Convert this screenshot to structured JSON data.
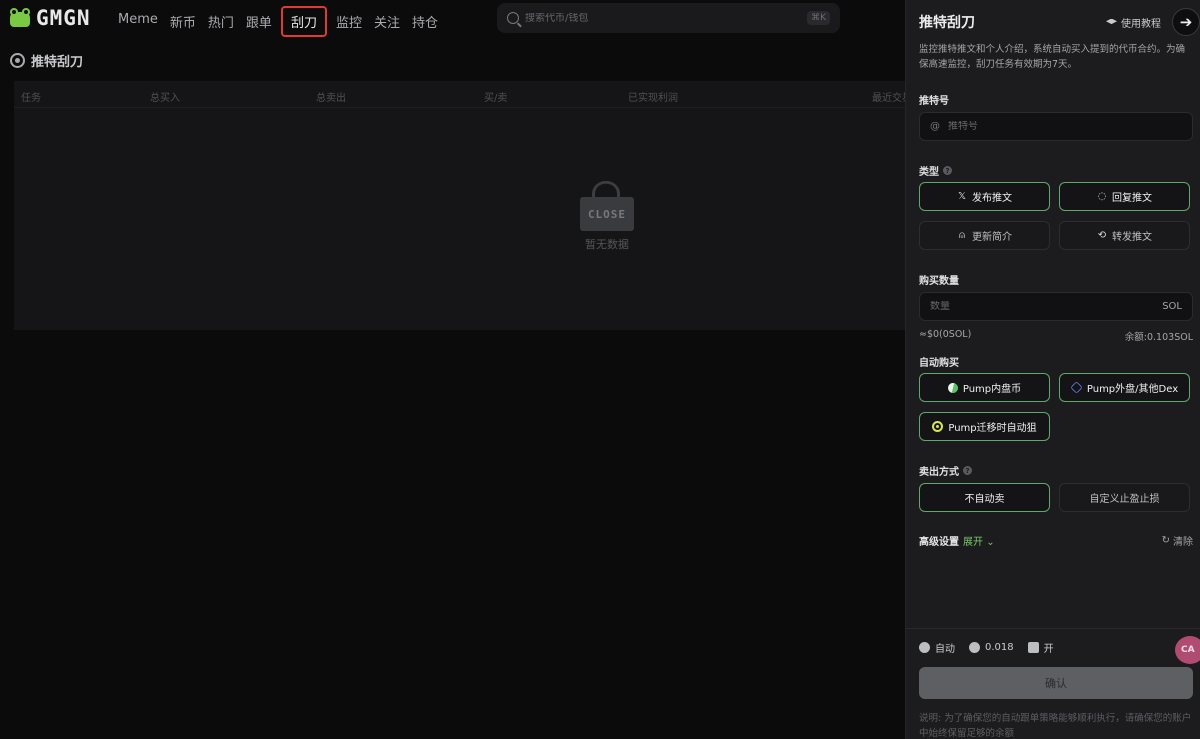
{
  "logo": {
    "text": "GMGN"
  },
  "nav": {
    "items": [
      {
        "label": "Meme"
      },
      {
        "label": "新币"
      },
      {
        "label": "热门"
      },
      {
        "label": "跟单"
      },
      {
        "label": "刮刀"
      },
      {
        "label": "监控"
      },
      {
        "label": "关注"
      },
      {
        "label": "持仓"
      }
    ],
    "active_index": 4
  },
  "search": {
    "placeholder": "搜索代币/钱包",
    "shortcut": "⌘K"
  },
  "section": {
    "title": "推特刮刀"
  },
  "table": {
    "columns": [
      "任务",
      "总买入",
      "总卖出",
      "买/卖",
      "已实现利润",
      "最近交易"
    ],
    "empty_badge": "CLOSE",
    "empty_text": "暂无数据"
  },
  "panel": {
    "title": "推特刮刀",
    "tutorial_label": "使用教程",
    "description": "监控推特推文和个人介绍，系统自动买入提到的代币合约。为确保高速监控，刮刀任务有效期为7天。",
    "twitter_label": "推特号",
    "twitter_prefix": "@",
    "twitter_placeholder": "推特号",
    "type_label": "类型",
    "type_options": [
      {
        "label": "发布推文",
        "icon": "x-icon",
        "selected": true
      },
      {
        "label": "回复推文",
        "icon": "comment-icon",
        "selected": true
      },
      {
        "label": "更新简介",
        "icon": "user-icon",
        "selected": false
      },
      {
        "label": "转发推文",
        "icon": "retweet-icon",
        "selected": false
      }
    ],
    "amount_label": "购买数量",
    "amount_placeholder": "数量",
    "amount_unit": "SOL",
    "amount_usd": "≈$0(0SOL)",
    "balance": "余额:0.103SOL",
    "auto_buy_label": "自动购买",
    "auto_buy_options": [
      {
        "label": "Pump内盘币",
        "icon": "pill-icon",
        "selected": true
      },
      {
        "label": "Pump外盘/其他Dex",
        "icon": "dex-icon",
        "selected": true
      },
      {
        "label": "Pump迁移时自动狙",
        "icon": "target-icon",
        "selected": true
      }
    ],
    "sell_label": "卖出方式",
    "sell_options": [
      {
        "label": "不自动卖",
        "selected": true
      },
      {
        "label": "自定义止盈止损",
        "selected": false
      }
    ],
    "advanced_label": "高级设置",
    "advanced_expand": "展开",
    "clear_label": "清除",
    "stats": {
      "auto": "自动",
      "fee": "0.018",
      "mev": "开"
    },
    "confirm_label": "确认",
    "note": "说明: 为了确保您的自动跟单策略能够顺利执行，请确保您的账户中始终保留足够的余额"
  },
  "floater_text": "CA",
  "colors": {
    "accent_green": "#5fa86c",
    "active_nav_border": "#e23a2e",
    "background": "#0b0b0c",
    "panel": "#1c1c1f"
  }
}
